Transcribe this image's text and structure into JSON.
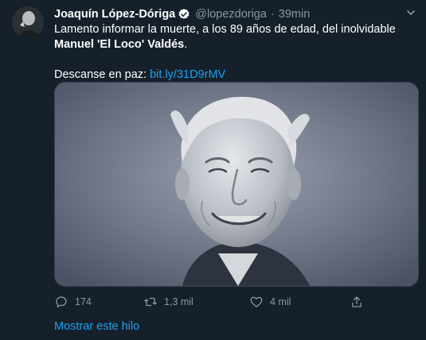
{
  "author": {
    "name": "Joaquín López-Dóriga",
    "handle": "@lopezdoriga",
    "separator": "·",
    "time": "39min"
  },
  "tweet": {
    "line1": "Lamento informar la muerte, a los 89 años de edad, del inolvidable",
    "line2_bold": "Manuel 'El Loco' Valdés",
    "line2_end": ".",
    "line3_prefix": "Descanse en paz: ",
    "link": "bit.ly/31D9rMV"
  },
  "actions": {
    "replies": "174",
    "retweets": "1,3 mil",
    "likes": "4 mil"
  },
  "footer": {
    "show_thread": "Mostrar este hilo"
  },
  "colors": {
    "background": "#15202b",
    "accent": "#1da1f2",
    "secondary_text": "#8899a6",
    "border": "#38444d"
  },
  "icons": {
    "verified": "verified-badge-icon",
    "caret": "chevron-down-icon",
    "reply": "reply-icon",
    "retweet": "retweet-icon",
    "like": "heart-icon",
    "share": "share-icon"
  }
}
